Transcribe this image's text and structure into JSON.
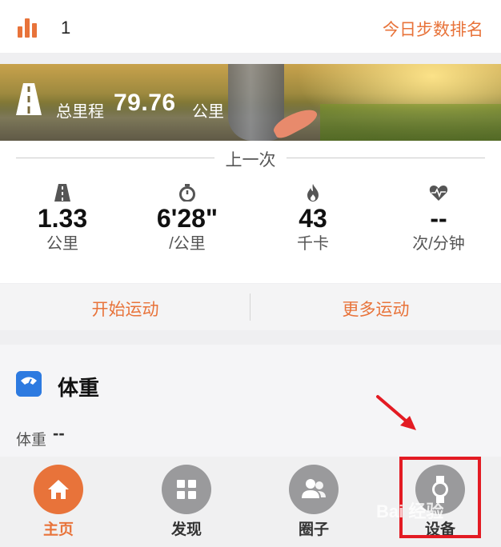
{
  "rank": {
    "number": "1",
    "link_label": "今日步数排名"
  },
  "banner": {
    "label": "总里程",
    "value": "79.76",
    "unit": "公里"
  },
  "last_session": {
    "title": "上一次",
    "stats": [
      {
        "icon": "road-icon",
        "value": "1.33",
        "unit": "公里"
      },
      {
        "icon": "stopwatch-icon",
        "value": "6'28\"",
        "unit": "/公里"
      },
      {
        "icon": "flame-icon",
        "value": "43",
        "unit": "千卡"
      },
      {
        "icon": "heart-rate-icon",
        "value": "--",
        "unit": "次/分钟"
      }
    ]
  },
  "actions": {
    "start": "开始运动",
    "more": "更多运动"
  },
  "weight": {
    "title": "体重",
    "label": "体重",
    "value": "--"
  },
  "tabs": [
    {
      "icon": "home-icon",
      "label": "主页",
      "active": true
    },
    {
      "icon": "grid-icon",
      "label": "发现",
      "active": false
    },
    {
      "icon": "people-icon",
      "label": "圈子",
      "active": false
    },
    {
      "icon": "watch-icon",
      "label": "设备",
      "active": false
    }
  ],
  "watermark": "Bai 经验",
  "colors": {
    "accent": "#e8733a",
    "annotation": "#e31b23",
    "scale_icon": "#2d7ae0",
    "inactive_tab": "#9a9a9c"
  }
}
